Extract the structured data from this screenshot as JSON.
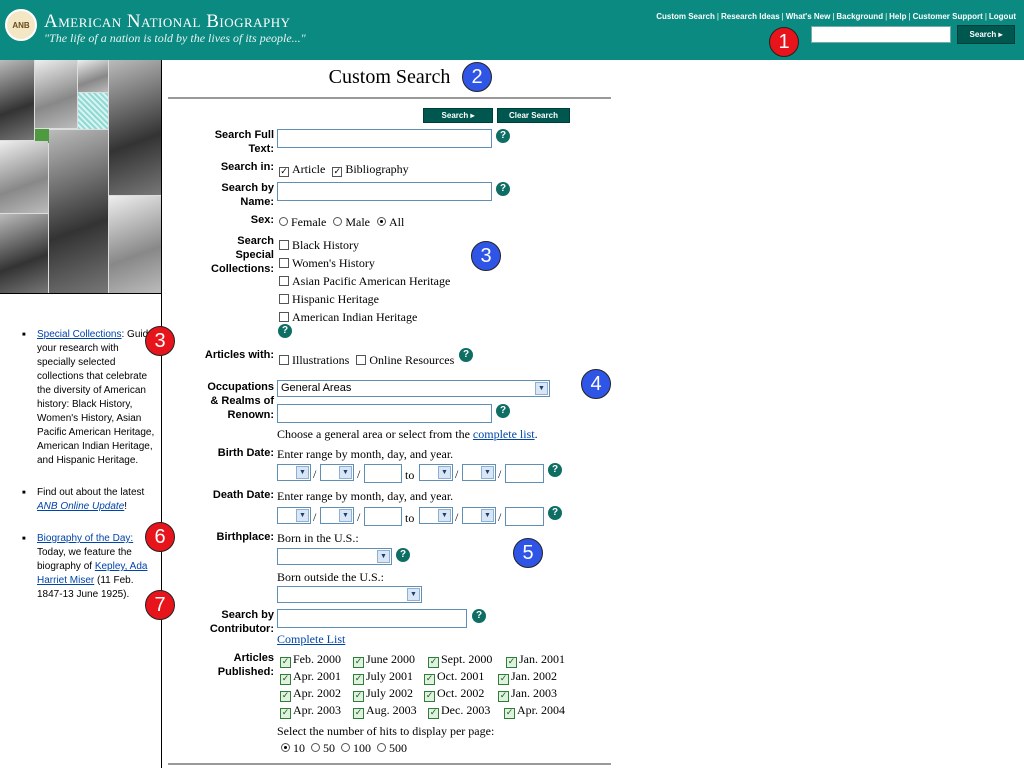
{
  "header": {
    "seal_text": "ANB",
    "title": "American National Biography",
    "tagline": "\"The life of a nation is told by the lives of its people...\"",
    "nav": [
      "Custom Search",
      "Research Ideas",
      "What's New",
      "Background",
      "Help",
      "Customer Support",
      "Logout"
    ],
    "search_button": "Search ▸"
  },
  "page": {
    "title": "Custom Search",
    "search_button": "Search ▸",
    "clear_button": "Clear Search"
  },
  "form": {
    "full_text_label": "Search Full Text:",
    "search_in_label": "Search in:",
    "search_in": [
      "Article",
      "Bibliography"
    ],
    "by_name_label": "Search by Name:",
    "sex_label": "Sex:",
    "sex_options": [
      "Female",
      "Male",
      "All"
    ],
    "collections_label": "Search Special Collections:",
    "collections": [
      "Black History",
      "Women's History",
      "Asian Pacific American Heritage",
      "Hispanic Heritage",
      "American Indian Heritage"
    ],
    "articles_with_label": "Articles with:",
    "articles_with": [
      "Illustrations",
      "Online Resources"
    ],
    "occupations_label": "Occupations & Realms of Renown:",
    "occupations_value": "General Areas",
    "occupations_hint": "Choose a general area or select from the",
    "complete_list": "complete list",
    "birth_label": "Birth Date:",
    "death_label": "Death Date:",
    "date_hint": "Enter range by month, day, and year.",
    "to": "to",
    "slash": "/",
    "birthplace_label": "Birthplace:",
    "born_us": "Born in the U.S.:",
    "born_outside": "Born outside the U.S.:",
    "contributor_label": "Search by Contributor:",
    "contributor_link": "Complete List",
    "published_label": "Articles Published:",
    "published": [
      "Feb. 2000",
      "June 2000",
      "Sept. 2000",
      "Jan. 2001",
      "Apr. 2001",
      "July 2001",
      "Oct. 2001",
      "Jan. 2002",
      "Apr. 2002",
      "July 2002",
      "Oct. 2002",
      "Jan. 2003",
      "Apr. 2003",
      "Aug. 2003",
      "Dec. 2003",
      "Apr. 2004"
    ],
    "hits_label": "Select the number of hits to display per page:",
    "hits": [
      "10",
      "50",
      "100",
      "500"
    ]
  },
  "sidebar": {
    "item1_link": "Special Collections",
    "item1_text": ": Guide your research with specially selected collections that celebrate the diversity of American history: Black History, Women's History, Asian Pacific American Heritage, American Indian Heritage, and Hispanic Heritage.",
    "item2_pre": "Find out about the latest ",
    "item2_link": "ANB Online Update",
    "item2_post": "!",
    "item3_link": "Biography of the Day:",
    "item3_pre": " Today, we feature the biography of ",
    "item3_name": "Kepley, Ada Harriet Miser",
    "item3_post": " (11 Feb. 1847-13 June 1925)."
  },
  "badges": [
    "1",
    "2",
    "3",
    "3",
    "4",
    "5",
    "6",
    "7"
  ],
  "colors": {
    "header": "#0b8a82",
    "button": "#00574f",
    "badge_red": "#e8141b",
    "badge_blue": "#2f55e6",
    "help": "#0f6e64"
  }
}
